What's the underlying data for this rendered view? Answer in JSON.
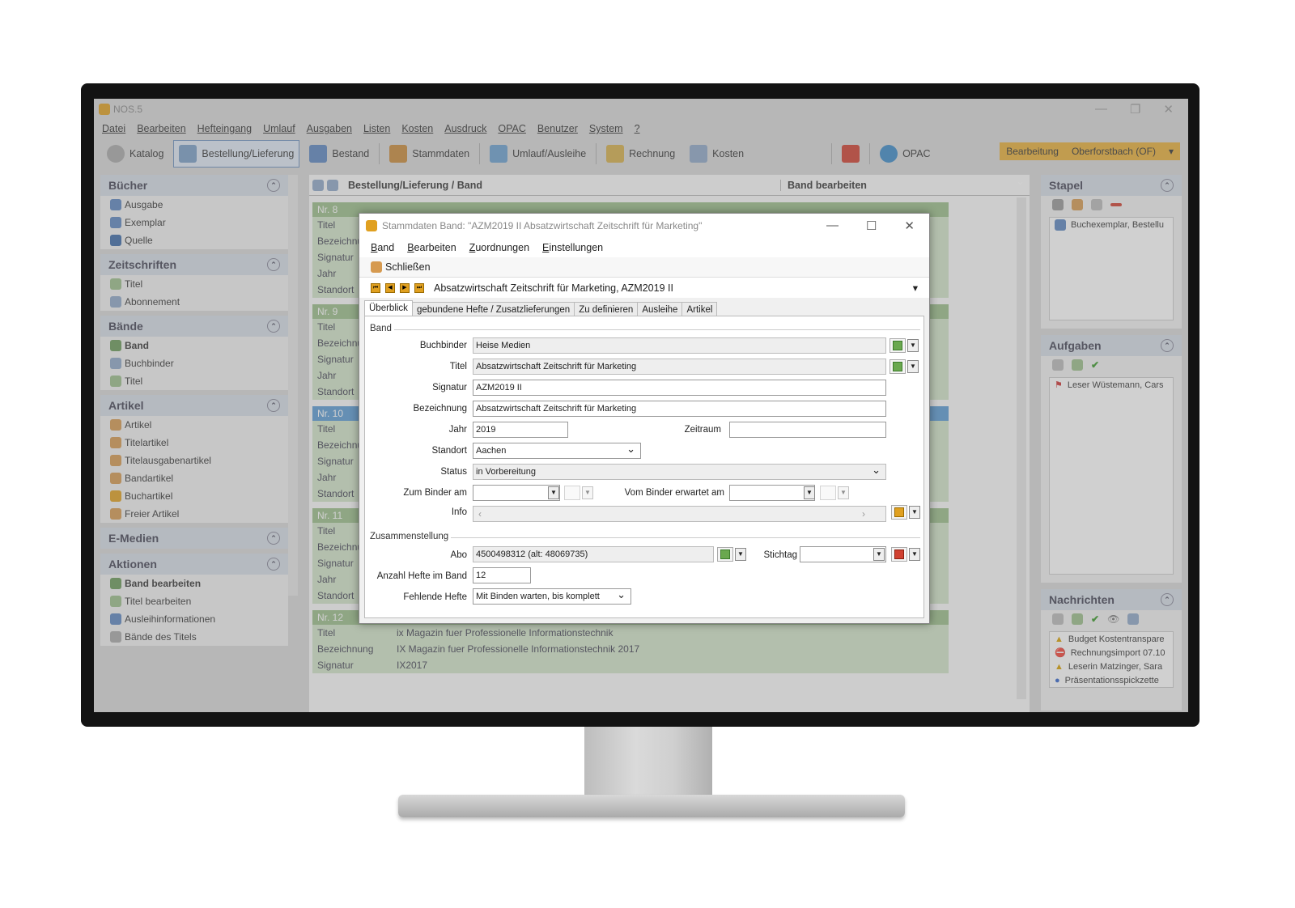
{
  "app": {
    "title": "NOS.5",
    "menu": [
      "Datei",
      "Bearbeiten",
      "Hefteingang",
      "Umlauf",
      "Ausgaben",
      "Listen",
      "Kosten",
      "Ausdruck",
      "OPAC",
      "Benutzer",
      "System",
      "?"
    ],
    "toolbar": [
      "Katalog",
      "Bestellung/Lieferung",
      "Bestand",
      "Stammdaten",
      "Umlauf/Ausleihe",
      "Rechnung",
      "Kosten",
      "OPAC"
    ],
    "status_mode": "Bearbeitung",
    "status_location": "Oberforstbach (OF)"
  },
  "left": {
    "panels": [
      {
        "title": "Bücher",
        "items": [
          "Ausgabe",
          "Exemplar",
          "Quelle"
        ]
      },
      {
        "title": "Zeitschriften",
        "items": [
          "Titel",
          "Abonnement"
        ]
      },
      {
        "title": "Bände",
        "items": [
          "Band",
          "Buchbinder",
          "Titel"
        ]
      },
      {
        "title": "Artikel",
        "items": [
          "Artikel",
          "Titelartikel",
          "Titelausgabenartikel",
          "Bandartikel",
          "Buchartikel",
          "Freier Artikel"
        ]
      },
      {
        "title": "E-Medien",
        "items": []
      }
    ],
    "actions_title": "Aktionen",
    "actions": [
      "Band bearbeiten",
      "Titel bearbeiten",
      "Ausleihinformationen",
      "Bände des Titels"
    ]
  },
  "center": {
    "breadcrumb": "Bestellung/Lieferung / Band",
    "pane_title": "Band bearbeiten",
    "cards": [
      {
        "nr": "Nr. 8",
        "rows": [
          [
            "Titel",
            ""
          ],
          [
            "Bezeichnu",
            ""
          ],
          [
            "Signatur",
            ""
          ],
          [
            "Jahr",
            ""
          ],
          [
            "Standort",
            ""
          ]
        ]
      },
      {
        "nr": "Nr. 9",
        "rows": [
          [
            "Titel",
            ""
          ],
          [
            "Bezeichnu",
            ""
          ],
          [
            "Signatur",
            ""
          ],
          [
            "Jahr",
            ""
          ],
          [
            "Standort",
            ""
          ]
        ]
      },
      {
        "nr": "Nr. 10",
        "rows": [
          [
            "Titel",
            ""
          ],
          [
            "Bezeichnu",
            ""
          ],
          [
            "Signatur",
            ""
          ],
          [
            "Jahr",
            ""
          ],
          [
            "Standort",
            ""
          ]
        ]
      },
      {
        "nr": "Nr. 11",
        "rows": [
          [
            "Titel",
            ""
          ],
          [
            "Bezeichnu",
            ""
          ],
          [
            "Signatur",
            ""
          ],
          [
            "Jahr",
            ""
          ],
          [
            "Standort",
            ""
          ]
        ]
      },
      {
        "nr": "Nr. 12",
        "rows": [
          [
            "Titel",
            "ix Magazin fuer Professionelle Informationstechnik"
          ],
          [
            "Bezeichnung",
            "IX Magazin fuer Professionelle Informationstechnik 2017"
          ],
          [
            "Signatur",
            "IX2017"
          ]
        ]
      }
    ]
  },
  "right": {
    "stapel_title": "Stapel",
    "stapel_items": [
      "Buchexemplar, Bestellu"
    ],
    "aufgaben_title": "Aufgaben",
    "aufgaben_items": [
      "Leser Wüstemann, Cars"
    ],
    "nachrichten_title": "Nachrichten",
    "nachrichten_items": [
      "Budget Kostentranspare",
      "Rechnungsimport 07.10",
      "Leserin Matzinger, Sara",
      "Präsentationsspickzette"
    ]
  },
  "dialog": {
    "title": "Stammdaten Band: \"AZM2019 II Absatzwirtschaft Zeitschrift für Marketing\"",
    "menu": [
      "Band",
      "Bearbeiten",
      "Zuordnungen",
      "Einstellungen"
    ],
    "close_label": "Schließen",
    "record": "Absatzwirtschaft Zeitschrift für Marketing, AZM2019 II",
    "tabs": [
      "Überblick",
      "gebundene Hefte / Zusatzlieferungen",
      "Zu definieren",
      "Ausleihe",
      "Artikel"
    ],
    "group_band": "Band",
    "group_zusammen": "Zusammenstellung",
    "labels": {
      "buchbinder": "Buchbinder",
      "titel": "Titel",
      "signatur": "Signatur",
      "bezeichnung": "Bezeichnung",
      "jahr": "Jahr",
      "zeitraum": "Zeitraum",
      "standort": "Standort",
      "status": "Status",
      "zum_binder": "Zum Binder am",
      "vom_binder": "Vom Binder erwartet am",
      "info": "Info",
      "abo": "Abo",
      "stichtag": "Stichtag",
      "anzahl": "Anzahl Hefte im Band",
      "fehlende": "Fehlende Hefte"
    },
    "values": {
      "buchbinder": "Heise Medien",
      "titel": "Absatzwirtschaft Zeitschrift für Marketing",
      "signatur": "AZM2019 II",
      "bezeichnung": "Absatzwirtschaft Zeitschrift für Marketing",
      "jahr": "2019",
      "zeitraum": "",
      "standort": "Aachen",
      "status": "in Vorbereitung",
      "zum_binder": "",
      "vom_binder": "",
      "info": "",
      "abo": "4500498312 (alt: 48069735)",
      "stichtag": "",
      "anzahl": "12",
      "fehlende": "Mit Binden warten, bis komplett"
    }
  },
  "colors": {
    "accent": "#5b9bd5",
    "card_header": "#9cbf8b",
    "card_bg": "#d3e5c9",
    "status_bar": "#e8b03a"
  }
}
